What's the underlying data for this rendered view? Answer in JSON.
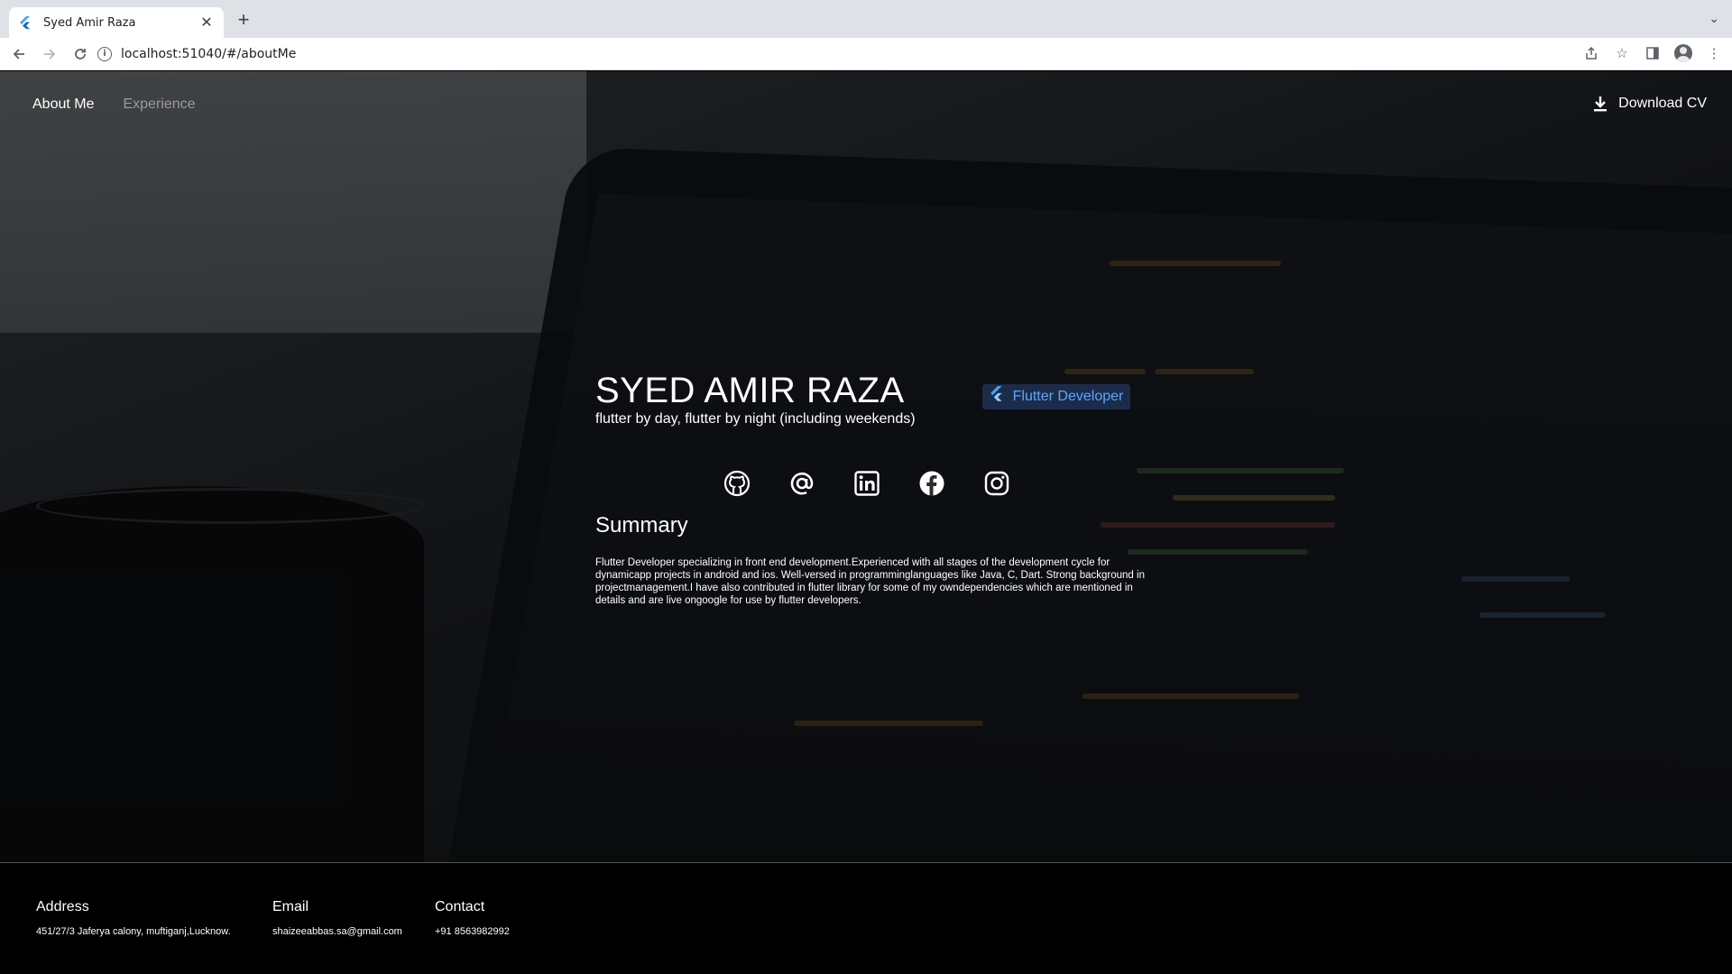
{
  "browser": {
    "tab_title": "Syed Amir Raza",
    "url": "localhost:51040/#/aboutMe"
  },
  "nav": {
    "items": [
      {
        "label": "About Me",
        "active": true
      },
      {
        "label": "Experience",
        "active": false
      }
    ],
    "download_label": "Download CV"
  },
  "profile": {
    "name": "SYED AMIR RAZA",
    "role_chip": "Flutter Developer",
    "tagline": "flutter by day, flutter by night (including weekends)",
    "socials": [
      "github-icon",
      "at-email-icon",
      "linkedin-icon",
      "facebook-icon",
      "instagram-icon"
    ]
  },
  "summary": {
    "title": "Summary",
    "text": "Flutter Developer specializing in front end development.Experienced with all stages of the development cycle for dynamicapp projects in android and ios. Well-versed in programminglanguages like Java, C, Dart. Strong background in projectmanagement.I have also contributed in flutter library for some of my owndependencies which are mentioned in details and are live ongoogle for use by flutter developers."
  },
  "footer": {
    "address_label": "Address",
    "address_value": "451/27/3 Jaferya calony, muftiganj,Lucknow.",
    "email_label": "Email",
    "email_value": "shaizeeabbas.sa@gmail.com",
    "contact_label": "Contact",
    "contact_value": "+91 8563982992"
  },
  "colors": {
    "accent_blue": "#60a5fa",
    "flutter_blue": "#42a5f5"
  }
}
